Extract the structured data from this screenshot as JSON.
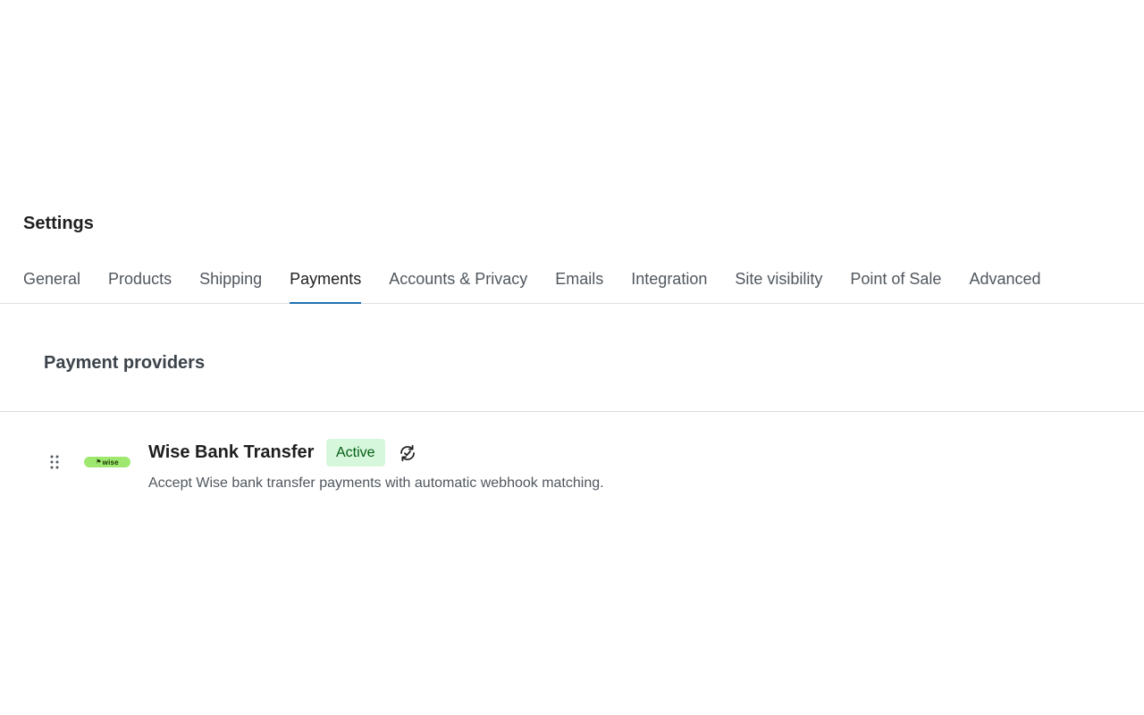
{
  "header": {
    "title": "Settings"
  },
  "tabs": [
    {
      "label": "General",
      "active": false
    },
    {
      "label": "Products",
      "active": false
    },
    {
      "label": "Shipping",
      "active": false
    },
    {
      "label": "Payments",
      "active": true
    },
    {
      "label": "Accounts & Privacy",
      "active": false
    },
    {
      "label": "Emails",
      "active": false
    },
    {
      "label": "Integration",
      "active": false
    },
    {
      "label": "Site visibility",
      "active": false
    },
    {
      "label": "Point of Sale",
      "active": false
    },
    {
      "label": "Advanced",
      "active": false
    }
  ],
  "section": {
    "title": "Payment providers"
  },
  "providers": [
    {
      "logo_text": "wise",
      "name": "Wise Bank Transfer",
      "status": "Active",
      "description": "Accept Wise bank transfer payments with automatic webhook matching.",
      "icons": {
        "drag": "drag-handle-icon",
        "sync": "sync-icon"
      }
    }
  ],
  "colors": {
    "accent": "#2271b1",
    "badge_bg": "#d7f7dc",
    "badge_text": "#005c12",
    "wise_green": "#9fe870"
  }
}
